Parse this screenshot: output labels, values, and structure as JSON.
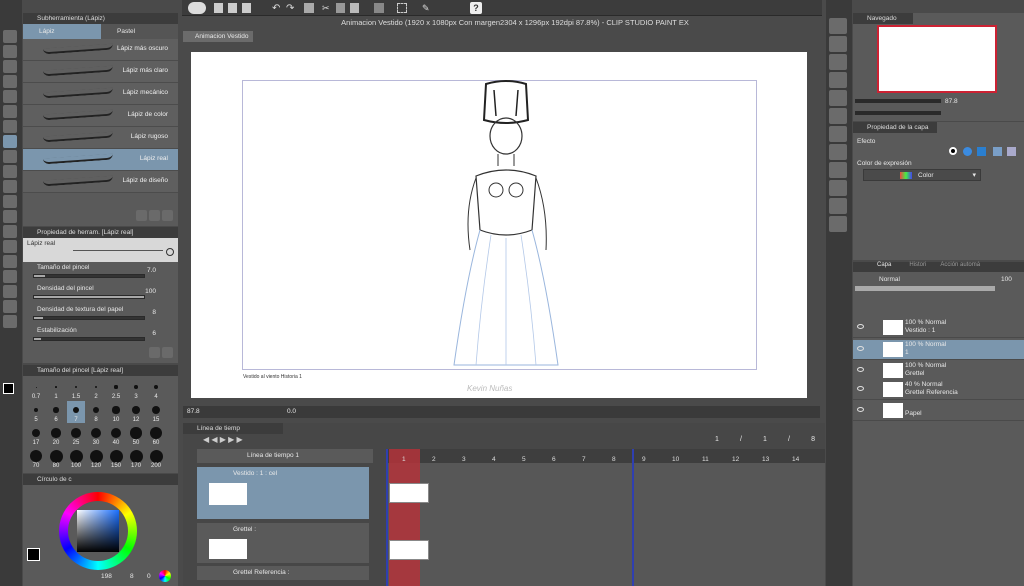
{
  "window_title": "Animacion Vestido (1920 x 1080px Con margen2304 x 1296px 192dpi 87.8%) - CLIP STUDIO PAINT EX",
  "canvas_tab": "Animacion Vestido",
  "subtool_panel": {
    "title": "Subherramienta (Lápiz)",
    "tabs": [
      "Lápiz",
      "Pastel"
    ],
    "brushes": [
      "Lápiz más oscuro",
      "Lápiz más claro",
      "Lápiz mecánico",
      "Lápiz de color",
      "Lápiz rugoso",
      "Lápiz real",
      "Lápiz de diseño"
    ],
    "selected_index": 5
  },
  "tool_property": {
    "title": "Propiedad de herram. [Lápiz real]",
    "preview_label": "Lápiz real",
    "rows": [
      {
        "label": "Tamaño del pincel",
        "value": "7.0",
        "fill": 0.1
      },
      {
        "label": "Densidad del pincel",
        "value": "100",
        "fill": 1.0
      },
      {
        "label": "Densidad de textura del papel",
        "value": "8",
        "fill": 0.08
      },
      {
        "label": "Estabilización",
        "value": "6",
        "fill": 0.06
      }
    ]
  },
  "brush_size": {
    "title": "Tamaño del pincel [Lápiz real]",
    "sizes": [
      "0.7",
      "1",
      "1.5",
      "2",
      "2.5",
      "3",
      "4",
      "5",
      "6",
      "7",
      "8",
      "10",
      "12",
      "15",
      "17",
      "20",
      "25",
      "30",
      "40",
      "50",
      "60",
      "70",
      "80",
      "100",
      "120",
      "150",
      "170",
      "200"
    ],
    "selected": "7"
  },
  "color_wheel": {
    "title": "Círculo de c",
    "value_a": "198",
    "value_b": "8",
    "value_c": "0"
  },
  "navigator": {
    "title": "Navegado",
    "zoom": "87.8"
  },
  "layer_property": {
    "title": "Propiedad de la capa",
    "effect_label": "Efecto",
    "expression_label": "Color de expresión",
    "expression_value": "Color"
  },
  "layers_panel": {
    "tabs": [
      "Capa",
      "Histori",
      "Acción automá"
    ],
    "blend_mode": "Normal",
    "opacity": "100",
    "layers": [
      {
        "line1": "100 % Normal",
        "line2": "Vestido : 1"
      },
      {
        "line1": "100 % Normal",
        "line2": "1"
      },
      {
        "line1": "100 % Normal",
        "line2": "Grettel"
      },
      {
        "line1": "40 % Normal",
        "line2": "Grettel Referencia"
      },
      {
        "line1": "",
        "line2": "Papel"
      }
    ]
  },
  "canvas": {
    "caption": "Vestido al viento Historia 1",
    "watermark": "Kevin Nuñas",
    "zoom": "87.8",
    "rotation": "0.0"
  },
  "timeline": {
    "title": "Línea de tiemp",
    "name": "Línea de tiempo 1",
    "frame_counter": [
      "1",
      "/",
      "1",
      "/",
      "8"
    ],
    "frames": [
      "1",
      "2",
      "3",
      "4",
      "5",
      "6",
      "7",
      "8",
      "9",
      "10",
      "11",
      "12",
      "13",
      "14"
    ],
    "tracks": [
      "Vestido : 1 : cel",
      "Grettel :",
      "Grettel Referencia :"
    ]
  },
  "colors": {
    "accent_selected": "#7b96ad",
    "playhead": "#c8323a",
    "end_marker": "#2f3fb0"
  }
}
